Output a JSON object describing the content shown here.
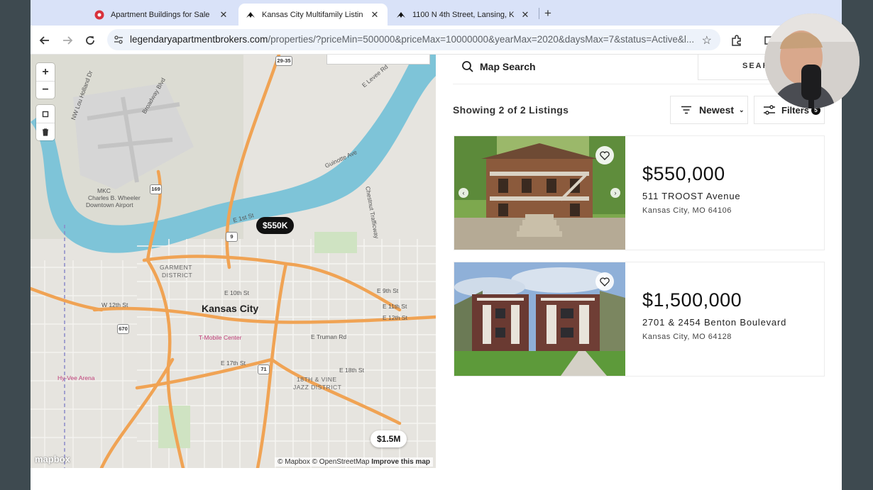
{
  "tabs": [
    {
      "title": "Apartment Buildings for Sale",
      "favicon": "red-flower-icon",
      "active": false
    },
    {
      "title": "Kansas City Multifamily Listin",
      "favicon": "brand-arrow-icon",
      "active": true
    },
    {
      "title": "1100 N 4th Street, Lansing, K",
      "favicon": "brand-arrow-icon",
      "active": false
    }
  ],
  "address_bar": {
    "domain": "legendaryapartmentbrokers.com",
    "path": "/properties/?priceMin=500000&priceMax=10000000&yearMax=2020&daysMax=7&status=Active&l..."
  },
  "map": {
    "city_label": "Kansas City",
    "labels": {
      "west_12th": "W 12th St",
      "garment": "GARMENT",
      "district": "DISTRICT",
      "e_10th": "E 10th St",
      "e_9th": "E 9th St",
      "e_11th": "E 11th St",
      "e_12th": "E 12th St",
      "e_truman": "E Truman Rd",
      "e_17th": "E 17th St",
      "e_18th": "E 18th St",
      "vine1": "18TH & VINE",
      "vine2": "JAZZ DISTRICT",
      "mobile_center": "T-Mobile Center",
      "arena": "Hy-Vee Arena",
      "guinotte": "Guinotte Ave",
      "first": "E 1st St",
      "levee": "E Levee Rd",
      "chestnut": "Chestnut Trafficway",
      "mkc": "MKC",
      "wheeler1": "Charles B. Wheeler",
      "wheeler2": "Downtown Airport",
      "lou": "NW Lou Holland Dr",
      "broadway": "Broadway Blvd"
    },
    "shields": {
      "s169": "169",
      "s9": "9",
      "s71": "71",
      "s670": "670",
      "s29": "29-35"
    },
    "pins": [
      {
        "label": "$550K"
      },
      {
        "label": "$1.5M"
      }
    ],
    "attribution": {
      "mapbox": "© Mapbox",
      "osm": "© OpenStreetMap",
      "improve": "Improve this map"
    },
    "logo": "mapbox"
  },
  "listing_panel": {
    "map_search": "Map Search",
    "search_button": "SEAR",
    "showing": "Showing 2 of 2 Listings",
    "sort": "Newest",
    "filters": "Filters",
    "filters_count": "5"
  },
  "listings": [
    {
      "price": "$550,000",
      "address": "511 TROOST Avenue",
      "city": "Kansas City, MO 64106"
    },
    {
      "price": "$1,500,000",
      "address": "2701 & 2454 Benton Boulevard",
      "city": "Kansas City, MO 64128"
    }
  ],
  "colors": {
    "accent": "#111111",
    "highway": "#f0a354",
    "river": "#7ec4d8",
    "tabstrip": "#d9e2f8"
  }
}
